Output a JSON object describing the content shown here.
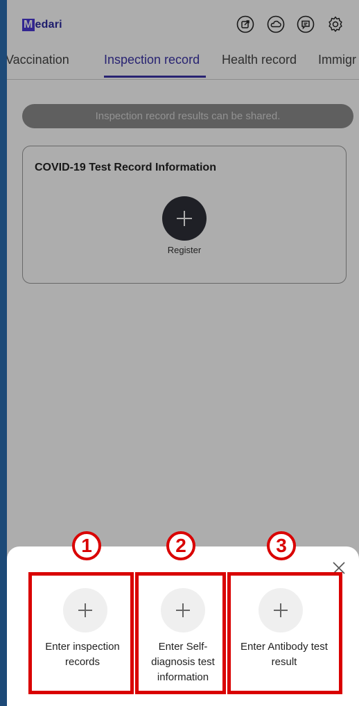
{
  "app": {
    "logo_first": "M",
    "logo_rest": "edari"
  },
  "header_icons": [
    "share-icon",
    "cloud-icon",
    "chat-icon",
    "settings-icon"
  ],
  "tabs": [
    {
      "label": "Vaccination",
      "active": false
    },
    {
      "label": "Inspection record",
      "active": true
    },
    {
      "label": "Health record",
      "active": false
    },
    {
      "label": "Immigr",
      "active": false
    }
  ],
  "banner": {
    "text": "Inspection record results can be shared."
  },
  "card": {
    "title": "COVID-19 Test Record Information",
    "register_label": "Register"
  },
  "sheet": {
    "options": [
      {
        "number": "1",
        "label_line1": "Enter inspection",
        "label_line2": "records",
        "label_line3": ""
      },
      {
        "number": "2",
        "label_line1": "Enter Self-",
        "label_line2": "diagnosis test",
        "label_line3": "information"
      },
      {
        "number": "3",
        "label_line1": "Enter Antibody test",
        "label_line2": "result",
        "label_line3": ""
      }
    ]
  },
  "colors": {
    "accent": "#3c34a8",
    "annotation_red": "#d90000",
    "background_blue": "#1d4a78"
  }
}
